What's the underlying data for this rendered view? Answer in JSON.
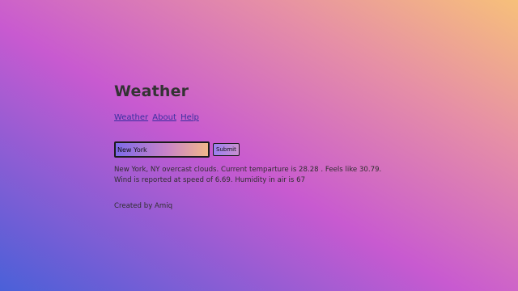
{
  "header": {
    "title": "Weather"
  },
  "nav": {
    "items": [
      {
        "label": "Weather"
      },
      {
        "label": "About"
      },
      {
        "label": "Help"
      }
    ]
  },
  "form": {
    "location_value": "New York",
    "submit_label": "Submit"
  },
  "result": {
    "line1": "New York, NY overcast clouds. Current temparture is 28.28 . Feels like 30.79.",
    "line2": "Wind is reported at speed of 6.69. Humidity in air is 67"
  },
  "footer": {
    "text": "Created by Amiq"
  }
}
